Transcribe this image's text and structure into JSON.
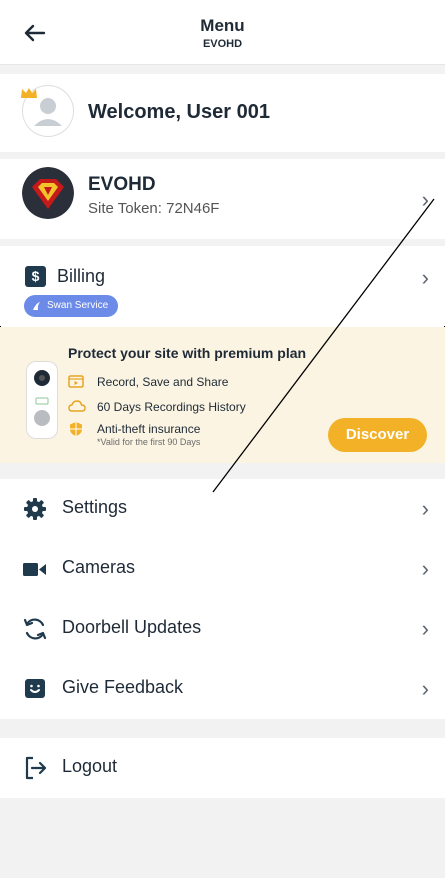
{
  "header": {
    "title": "Menu",
    "subtitle": "EVOHD"
  },
  "welcome": {
    "text": "Welcome, User 001"
  },
  "site": {
    "name": "EVOHD",
    "token": "Site Token: 72N46F"
  },
  "billing": {
    "label": "Billing",
    "badge": "Swan Service"
  },
  "promo": {
    "title": "Protect your site with premium plan",
    "features": [
      "Record, Save and Share",
      "60 Days Recordings History",
      "Anti-theft insurance"
    ],
    "note": "*Valid for the first 90 Days",
    "button": "Discover"
  },
  "menu": {
    "settings": "Settings",
    "cameras": "Cameras",
    "doorbell_updates": "Doorbell Updates",
    "give_feedback": "Give Feedback",
    "logout": "Logout"
  },
  "chevron": "›",
  "colors": {
    "accent": "#f2b126",
    "badge": "#6c8be8",
    "dark": "#1f3a4d",
    "promo_bg": "#fbf4e2"
  }
}
